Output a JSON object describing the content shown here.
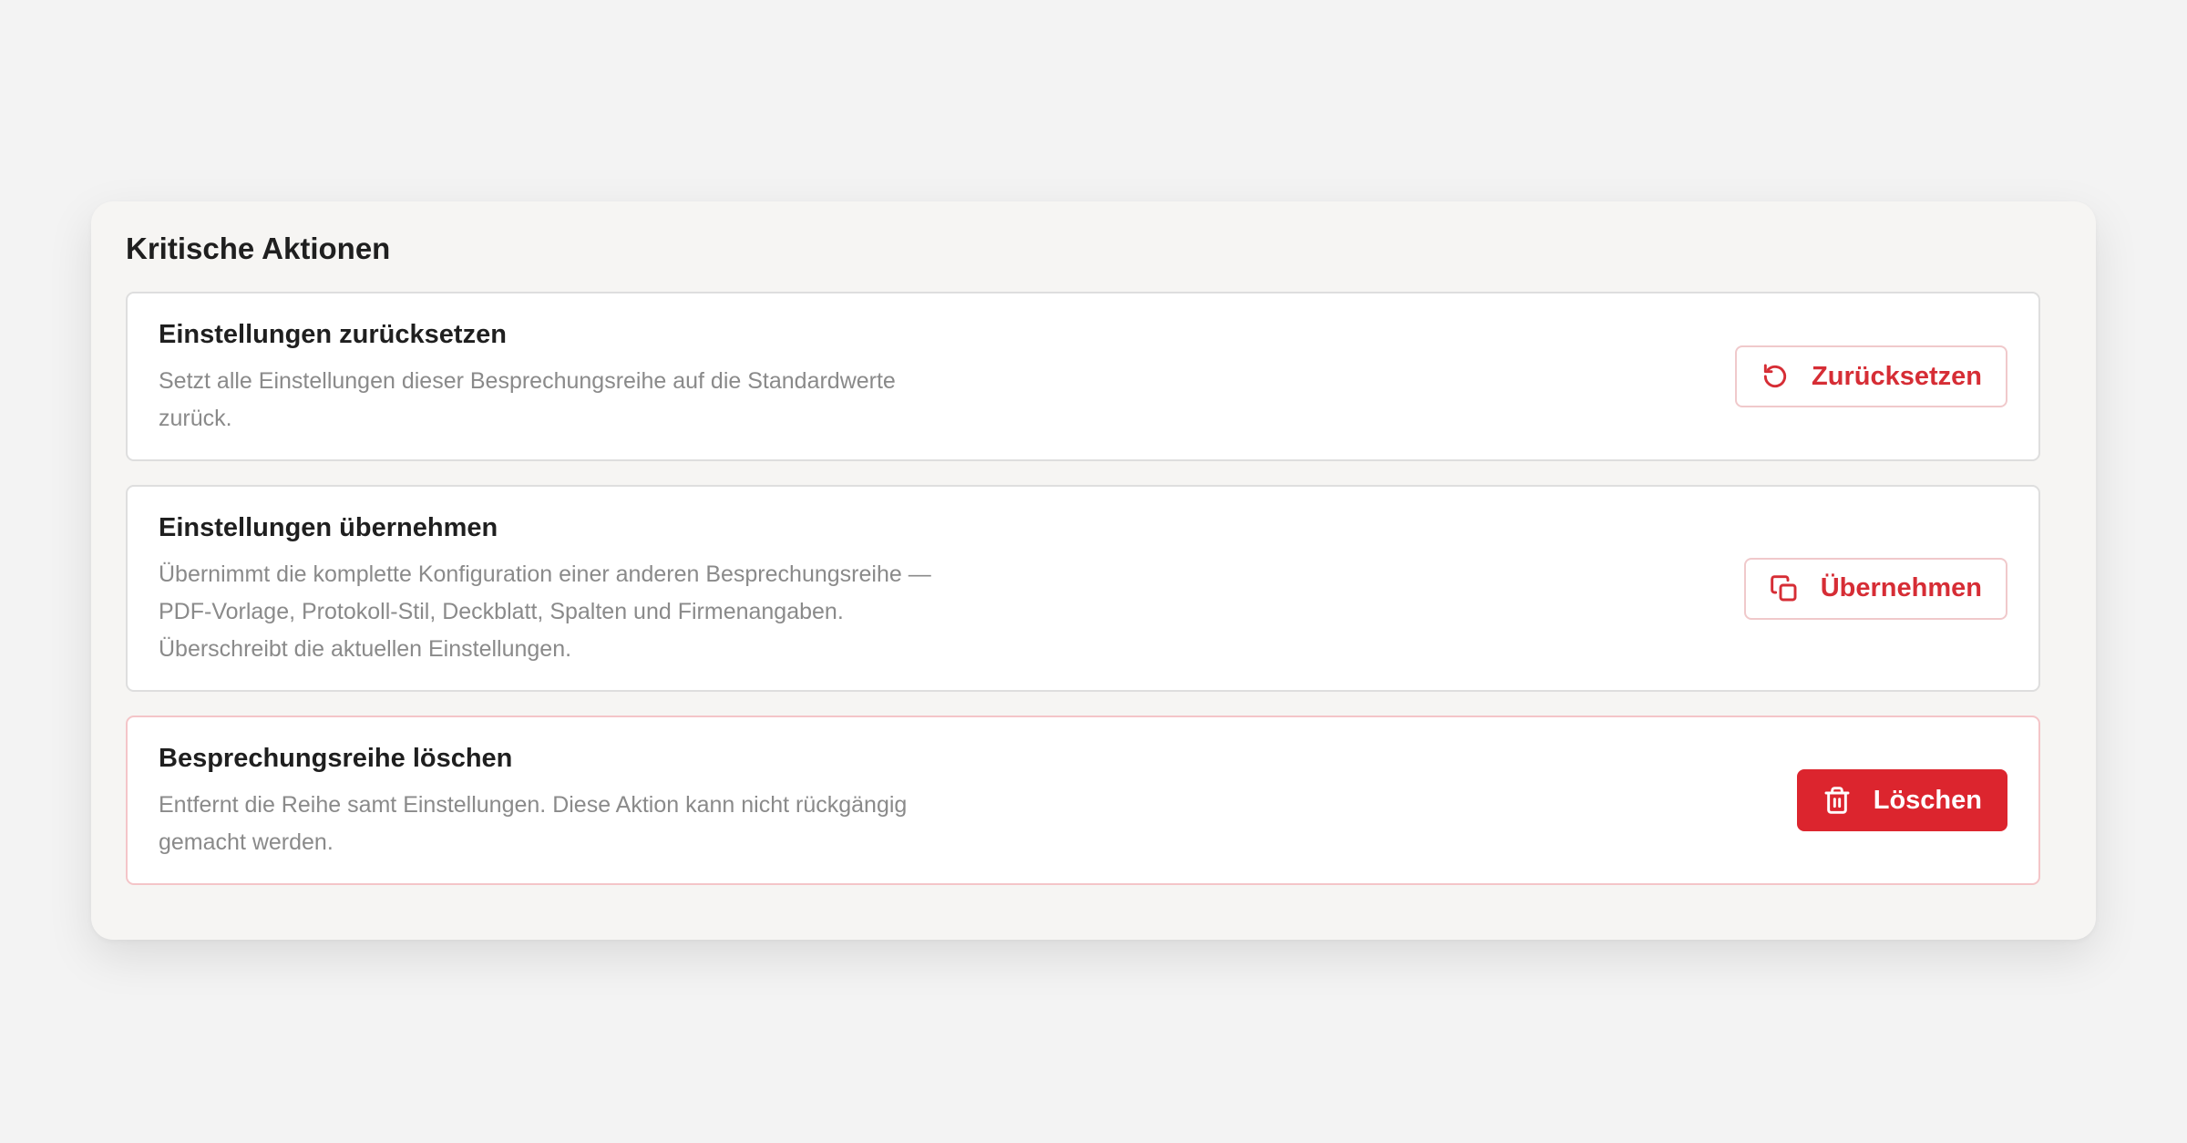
{
  "panel": {
    "title": "Kritische Aktionen"
  },
  "cards": [
    {
      "title": "Einstellungen zurücksetzen",
      "description_lines": [
        "Setzt alle Einstellungen dieser Besprechungsreihe auf die Standardwerte",
        "zurück."
      ],
      "button_label": "Zurücksetzen",
      "button_icon": "reset-icon"
    },
    {
      "title": "Einstellungen übernehmen",
      "description_lines": [
        "Übernimmt die komplette Konfiguration einer anderen Besprechungsreihe —",
        "PDF-Vorlage, Protokoll-Stil, Deckblatt, Spalten und Firmenangaben.",
        "Überschreibt die aktuellen Einstellungen."
      ],
      "button_label": "Übernehmen",
      "button_icon": "copy-icon"
    },
    {
      "title": "Besprechungsreihe löschen",
      "description_lines": [
        "Entfernt die Reihe samt Einstellungen. Diese Aktion kann nicht rückgängig",
        "gemacht werden."
      ],
      "button_label": "Löschen",
      "button_icon": "trash-icon"
    }
  ],
  "colors": {
    "danger": "#dc252e",
    "danger_text": "#d62d35",
    "danger_border": "#f0c9cb"
  }
}
